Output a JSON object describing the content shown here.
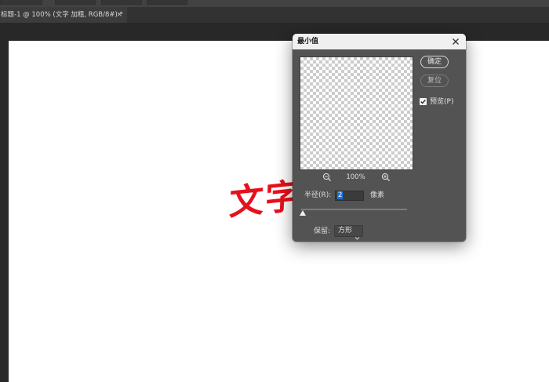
{
  "app": {
    "colors": {
      "workspace": "#282828",
      "dialog_bg": "#535353",
      "text_red": "#e8101b",
      "selection_blue": "#1473e6"
    }
  },
  "document_tab": {
    "title": "标题-1 @ 100% (文字 加粗, RGB/8#) *",
    "close_glyph": "×",
    "close_icon": "close-icon"
  },
  "canvas": {
    "text": "文字"
  },
  "dialog": {
    "title": "最小值",
    "close_icon": "close-icon",
    "ok_label": "确定",
    "reset_label": "复位",
    "preview_checkbox": {
      "label": "预览(P)",
      "checked": true
    },
    "zoom": {
      "level": "100%",
      "zoom_out_icon": "zoom-out-icon",
      "zoom_in_icon": "zoom-in-icon"
    },
    "radius": {
      "label": "半径(R):",
      "value": "2",
      "unit": "像素"
    },
    "preserve": {
      "label": "保留:",
      "selected": "方形",
      "chevron_icon": "chevron-down-icon"
    }
  }
}
